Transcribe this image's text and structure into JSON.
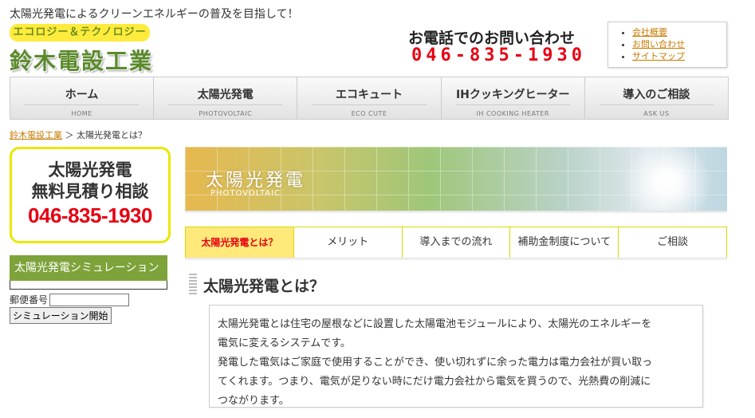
{
  "header": {
    "tagline": "太陽光発電によるクリーンエネルギーの普及を目指して！",
    "logo_badge": "エコロジー＆テクノロジー",
    "logo_name": "鈴木電設工業",
    "contact_title": "お電話でのお問い合わせ",
    "contact_phone": "046-835-1930",
    "links": [
      "会社概要",
      "お問い合わせ",
      "サイトマップ"
    ]
  },
  "global_nav": [
    {
      "jp": "ホーム",
      "en": "HOME"
    },
    {
      "jp": "太陽光発電",
      "en": "PHOTOVOLTAIC"
    },
    {
      "jp": "エコキュート",
      "en": "ECO CUTE"
    },
    {
      "jp": "IHクッキングヒーター",
      "en": "IH COOKING HEATER"
    },
    {
      "jp": "導入のご相談",
      "en": "ASK US"
    }
  ],
  "breadcrumb": {
    "home": "鈴木電設工業",
    "separator": "＞",
    "current": "太陽光発電とは？"
  },
  "sidebar": {
    "banner_line1": "太陽光発電",
    "banner_line2": "無料見積り相談",
    "banner_phone": "046-835-1930",
    "sim_title": "太陽光発電シミュレーション",
    "postal_label": "郵便番号",
    "postal_value": "",
    "sim_button": "シミュレーション開始"
  },
  "hero": {
    "title": "太陽光発電",
    "subtitle": "PHOTOVOLTAIC"
  },
  "sub_nav": [
    "太陽光発電とは？",
    "メリット",
    "導入までの流れ",
    "補助金制度について",
    "ご相談"
  ],
  "section_title": "太陽光発電とは？",
  "content_lines": [
    "太陽光発電とは住宅の屋根などに設置した太陽電池モジュールにより、太陽光のエネルギーを",
    "電気に変えるシステムです。",
    "発電した電気はご家庭で使用することができ、使い切れずに余った電力は電力会社が買い取っ",
    "てくれます。つまり、電気が足りない時にだけ電力会社から電気を買うので、光熱費の削減に",
    "つながります。"
  ],
  "colors": {
    "accent_red": "#e60012",
    "green": "#7da33a",
    "yellow": "#ffe97a",
    "link": "#c77b00"
  }
}
